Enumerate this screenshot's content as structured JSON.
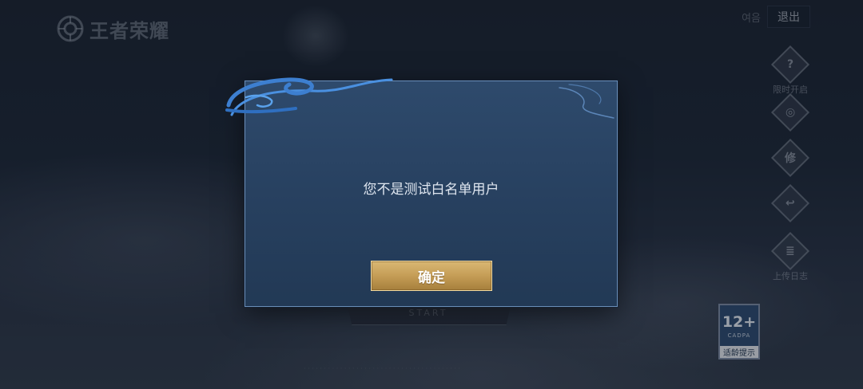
{
  "app": {
    "logo_text": "王者荣耀"
  },
  "top_right": {
    "muted_label": "여음",
    "logout_label": "退出"
  },
  "side_menu": [
    {
      "icon": "question-icon",
      "glyph": "?",
      "label": "限时开启"
    },
    {
      "icon": "target-icon",
      "glyph": "◎",
      "label": ""
    },
    {
      "icon": "repair-icon",
      "glyph": "修",
      "label": ""
    },
    {
      "icon": "back-icon",
      "glyph": "↩",
      "label": ""
    },
    {
      "icon": "log-icon",
      "glyph": "≣",
      "label": "上传日志"
    }
  ],
  "start_button": {
    "label": "START"
  },
  "age_rating": {
    "number": "12+",
    "org": "CADPA",
    "tip": "适龄提示"
  },
  "footer": {
    "text": "· · · · · · · · · · · · · · · · · · · · · · · · · · · · · · · · · · · · · · ·"
  },
  "dialog": {
    "message": "您不是测试白名单用户",
    "confirm_label": "确定"
  },
  "colors": {
    "dialog_bg": "#2e4a6c",
    "dialog_border": "#6a8eb8",
    "confirm_gold": "#c59d56",
    "deco_blue": "#3d7fd0"
  }
}
